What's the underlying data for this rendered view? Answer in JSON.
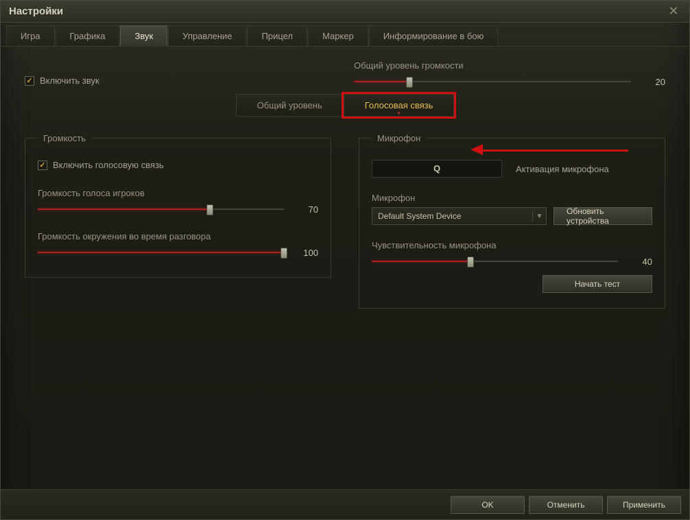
{
  "window": {
    "title": "Настройки"
  },
  "tabs": [
    "Игра",
    "Графика",
    "Звук",
    "Управление",
    "Прицел",
    "Маркер",
    "Информирование в бою"
  ],
  "active_tab_index": 2,
  "enable_sound": {
    "label": "Включить звук",
    "checked": true
  },
  "master_volume": {
    "label": "Общий уровень громкости",
    "value": 20
  },
  "subtabs": {
    "general": "Общий уровень",
    "voice": "Голосовая связь",
    "active_index": 1
  },
  "volume_section": {
    "legend": "Громкость",
    "enable_voice": {
      "label": "Включить голосовую связь",
      "checked": true
    },
    "players_volume": {
      "label": "Громкость голоса игроков",
      "value": 70
    },
    "ambient_volume": {
      "label": "Громкость окружения во время разговора",
      "value": 100
    }
  },
  "mic_section": {
    "legend": "Микрофон",
    "activation_key": "Q",
    "activation_label": "Активация микрофона",
    "device_label": "Микрофон",
    "selected_device": "Default System Device",
    "refresh_btn": "Обновить устройства",
    "sensitivity": {
      "label": "Чувствительность микрофона",
      "value": 40
    },
    "test_btn": "Начать тест"
  },
  "footer": {
    "ok": "OK",
    "cancel": "Отменить",
    "apply": "Применить"
  }
}
